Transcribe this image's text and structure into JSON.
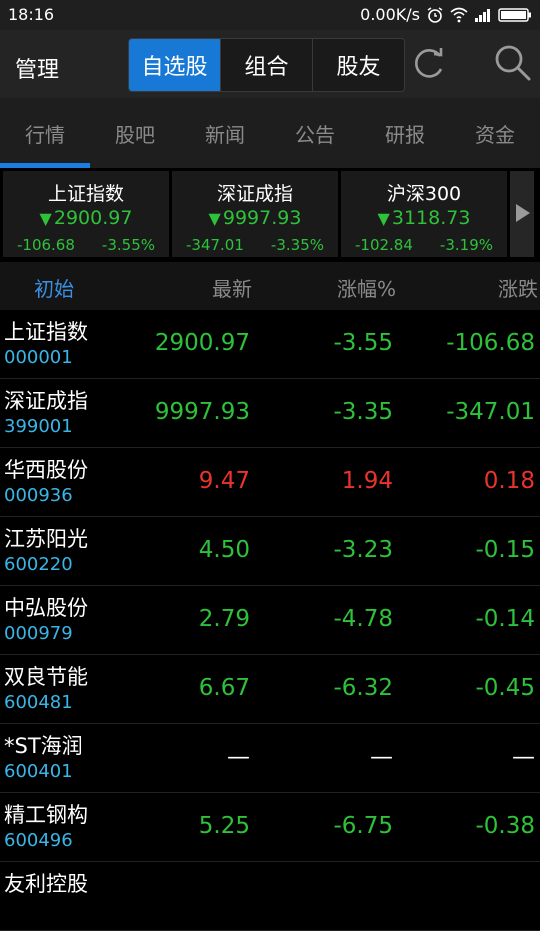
{
  "status": {
    "time": "18:16",
    "speed": "0.00K/s"
  },
  "header": {
    "manage": "管理",
    "segments": [
      "自选股",
      "组合",
      "股友"
    ]
  },
  "tabs": [
    "行情",
    "股吧",
    "新闻",
    "公告",
    "研报",
    "资金"
  ],
  "indices": [
    {
      "name": "上证指数",
      "price": "2900.97",
      "change": "-106.68",
      "pct": "-3.55%"
    },
    {
      "name": "深证成指",
      "price": "9997.93",
      "change": "-347.01",
      "pct": "-3.35%"
    },
    {
      "name": "沪深300",
      "price": "3118.73",
      "change": "-102.84",
      "pct": "-3.19%"
    }
  ],
  "columns": [
    "初始",
    "最新",
    "涨幅%",
    "涨跌"
  ],
  "stocks": [
    {
      "name": "上证指数",
      "code": "000001",
      "latest": "2900.97",
      "pct": "-3.55",
      "change": "-106.68"
    },
    {
      "name": "深证成指",
      "code": "399001",
      "latest": "9997.93",
      "pct": "-3.35",
      "change": "-347.01"
    },
    {
      "name": "华西股份",
      "code": "000936",
      "latest": "9.47",
      "pct": "1.94",
      "change": "0.18"
    },
    {
      "name": "江苏阳光",
      "code": "600220",
      "latest": "4.50",
      "pct": "-3.23",
      "change": "-0.15"
    },
    {
      "name": "中弘股份",
      "code": "000979",
      "latest": "2.79",
      "pct": "-4.78",
      "change": "-0.14"
    },
    {
      "name": "双良节能",
      "code": "600481",
      "latest": "6.67",
      "pct": "-6.32",
      "change": "-0.45"
    },
    {
      "name": "*ST海润",
      "code": "600401",
      "latest": "—",
      "pct": "—",
      "change": "—"
    },
    {
      "name": "精工钢构",
      "code": "600496",
      "latest": "5.25",
      "pct": "-6.75",
      "change": "-0.38"
    },
    {
      "name": "友利控股",
      "code": "",
      "latest": "",
      "pct": "",
      "change": ""
    }
  ],
  "colors": {
    "up": "#e8342b",
    "down": "#2ec13a",
    "accent": "#1878d6",
    "code": "#39b6e8"
  }
}
